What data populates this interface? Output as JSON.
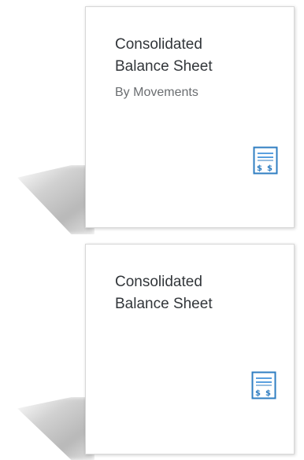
{
  "colors": {
    "title": "#32363a",
    "subtitle": "#6a6d70",
    "icon": "#2f7ec2",
    "icon_light": "#5aa0df",
    "tile_border": "#d7d7d7"
  },
  "tiles": [
    {
      "title": "Consolidated\nBalance Sheet",
      "subtitle": "By Movements",
      "icon": "balance-sheet-icon"
    },
    {
      "title": "Consolidated\nBalance Sheet",
      "icon": "balance-sheet-icon"
    }
  ]
}
